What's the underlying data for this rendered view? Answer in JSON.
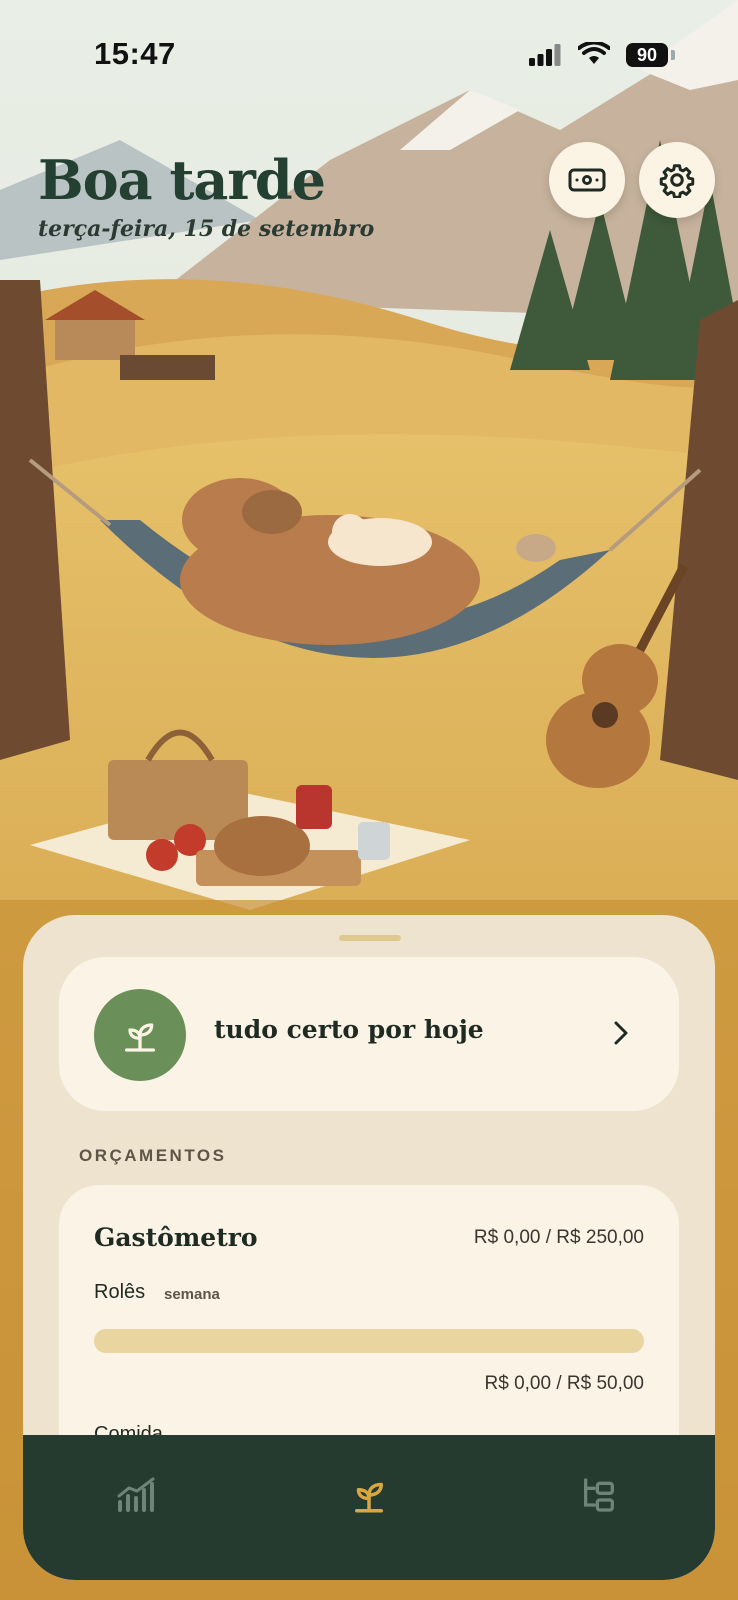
{
  "status_bar": {
    "time": "15:47",
    "battery": "90"
  },
  "header": {
    "greeting": "Boa tarde",
    "date": "terça-feira, 15 de setembro"
  },
  "actions": [
    {
      "icon": "money-icon"
    },
    {
      "icon": "gear-icon"
    }
  ],
  "status_card": {
    "text": "tudo certo por hoje",
    "icon": "sprout-icon"
  },
  "budgets": {
    "section_label": "ORÇAMENTOS",
    "card_title": "Gastômetro",
    "total": "R$ 0,00 / R$ 250,00",
    "categories": [
      {
        "name": "Rolês",
        "period": "semana",
        "amount": "R$ 0,00 / R$ 50,00",
        "progress": 0
      },
      {
        "name": "Comida"
      }
    ]
  },
  "nav": [
    {
      "icon": "chart-icon",
      "active": false
    },
    {
      "icon": "sprout-icon",
      "active": true
    },
    {
      "icon": "categories-icon",
      "active": false
    }
  ],
  "colors": {
    "accent_green": "#6a8f58",
    "nav_bg": "#253b30",
    "active_nav": "#d9a73f",
    "sheet_bg": "#ede3cf"
  }
}
